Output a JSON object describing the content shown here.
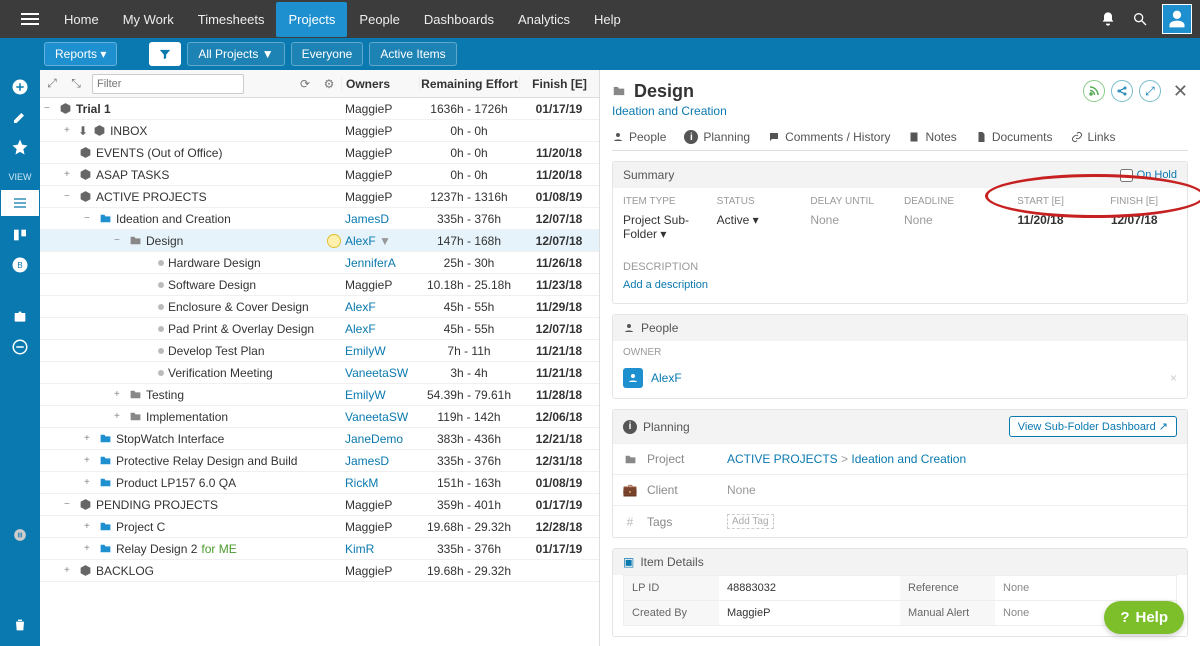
{
  "nav": {
    "items": [
      "Home",
      "My Work",
      "Timesheets",
      "Projects",
      "People",
      "Dashboards",
      "Analytics",
      "Help"
    ],
    "activeIndex": 3
  },
  "subnav": {
    "reports": "Reports ▾",
    "all_projects": "All Projects ▼",
    "everyone": "Everyone",
    "active_items": "Active Items"
  },
  "tree": {
    "filter_placeholder": "Filter",
    "headers": {
      "owners": "Owners",
      "effort": "Remaining Effort",
      "finish": "Finish [E]"
    },
    "rows": [
      {
        "indent": 0,
        "toggle": "−",
        "icon": "package",
        "label": "Trial 1",
        "owner": "MaggieP",
        "link": false,
        "effort": "1636h - 1726h",
        "finish": "01/17/19",
        "bold": true
      },
      {
        "indent": 1,
        "toggle": "+",
        "icon": "package",
        "pre": "download",
        "label": "INBOX",
        "owner": "MaggieP",
        "link": false,
        "effort": "0h - 0h",
        "finish": ""
      },
      {
        "indent": 1,
        "toggle": "",
        "icon": "package",
        "label": "EVENTS (Out of Office)",
        "owner": "MaggieP",
        "link": false,
        "effort": "0h - 0h",
        "finish": "11/20/18"
      },
      {
        "indent": 1,
        "toggle": "+",
        "icon": "package",
        "label": "ASAP TASKS",
        "owner": "MaggieP",
        "link": false,
        "effort": "0h - 0h",
        "finish": "11/20/18"
      },
      {
        "indent": 1,
        "toggle": "−",
        "icon": "package",
        "label": "ACTIVE PROJECTS",
        "owner": "MaggieP",
        "link": false,
        "effort": "1237h - 1316h",
        "finish": "01/08/19"
      },
      {
        "indent": 2,
        "toggle": "−",
        "icon": "folder-blue",
        "label": "Ideation and Creation",
        "owner": "JamesD",
        "link": true,
        "effort": "335h - 376h",
        "finish": "12/07/18"
      },
      {
        "indent": 3,
        "toggle": "−",
        "icon": "folder-grey",
        "label": "Design",
        "owner": "AlexF",
        "link": true,
        "ownerDrop": true,
        "effort": "147h - 168h",
        "finish": "12/07/18",
        "selected": true,
        "badge": true
      },
      {
        "indent": 4,
        "toggle": "",
        "icon": "task",
        "label": "Hardware Design",
        "owner": "JenniferA",
        "link": true,
        "effort": "25h - 30h",
        "finish": "11/26/18"
      },
      {
        "indent": 4,
        "toggle": "",
        "icon": "task",
        "label": "Software Design",
        "owner": "MaggieP",
        "link": false,
        "effort": "10.18h - 25.18h",
        "finish": "11/23/18"
      },
      {
        "indent": 4,
        "toggle": "",
        "icon": "task",
        "label": "Enclosure & Cover Design",
        "owner": "AlexF",
        "link": true,
        "effort": "45h - 55h",
        "finish": "11/29/18"
      },
      {
        "indent": 4,
        "toggle": "",
        "icon": "task",
        "label": "Pad Print & Overlay Design",
        "owner": "AlexF",
        "link": true,
        "effort": "45h - 55h",
        "finish": "12/07/18"
      },
      {
        "indent": 4,
        "toggle": "",
        "icon": "task",
        "label": "Develop Test Plan",
        "owner": "EmilyW",
        "link": true,
        "effort": "7h - 11h",
        "finish": "11/21/18"
      },
      {
        "indent": 4,
        "toggle": "",
        "icon": "task",
        "label": "Verification Meeting",
        "owner": "VaneetaSW",
        "link": true,
        "effort": "3h - 4h",
        "finish": "11/21/18"
      },
      {
        "indent": 3,
        "toggle": "+",
        "icon": "folder-grey",
        "label": "Testing",
        "owner": "EmilyW",
        "link": true,
        "effort": "54.39h - 79.61h",
        "finish": "11/28/18"
      },
      {
        "indent": 3,
        "toggle": "+",
        "icon": "folder-grey",
        "label": "Implementation",
        "owner": "VaneetaSW",
        "link": true,
        "effort": "119h - 142h",
        "finish": "12/06/18"
      },
      {
        "indent": 2,
        "toggle": "+",
        "icon": "folder-blue",
        "label": "StopWatch Interface",
        "owner": "JaneDemo",
        "link": true,
        "effort": "383h - 436h",
        "finish": "12/21/18"
      },
      {
        "indent": 2,
        "toggle": "+",
        "icon": "folder-blue",
        "label": "Protective Relay Design and Build",
        "owner": "JamesD",
        "link": true,
        "effort": "335h - 376h",
        "finish": "12/31/18"
      },
      {
        "indent": 2,
        "toggle": "+",
        "icon": "folder-blue",
        "label": "Product LP157 6.0 QA",
        "owner": "RickM",
        "link": true,
        "effort": "151h - 163h",
        "finish": "01/08/19"
      },
      {
        "indent": 1,
        "toggle": "−",
        "icon": "package",
        "label": "PENDING PROJECTS",
        "owner": "MaggieP",
        "link": false,
        "effort": "359h - 401h",
        "finish": "01/17/19"
      },
      {
        "indent": 2,
        "toggle": "+",
        "icon": "folder-blue",
        "label": "Project C",
        "owner": "MaggieP",
        "link": false,
        "effort": "19.68h - 29.32h",
        "finish": "12/28/18"
      },
      {
        "indent": 2,
        "toggle": "+",
        "icon": "folder-blue",
        "label": "Relay Design 2",
        "suffix": "for ME",
        "owner": "KimR",
        "link": true,
        "effort": "335h - 376h",
        "finish": "01/17/19"
      },
      {
        "indent": 1,
        "toggle": "+",
        "icon": "package",
        "label": "BACKLOG",
        "owner": "MaggieP",
        "link": false,
        "effort": "19.68h - 29.32h",
        "finish": ""
      }
    ]
  },
  "leftrail": {
    "view_label": "VIEW"
  },
  "detail": {
    "title": "Design",
    "breadcrumb": "Ideation and Creation",
    "tabs": [
      "People",
      "Planning",
      "Comments / History",
      "Notes",
      "Documents",
      "Links"
    ],
    "summary": {
      "header": "Summary",
      "onhold": "On Hold",
      "item_type_label": "ITEM TYPE",
      "item_type": "Project Sub-Folder ▾",
      "status_label": "STATUS",
      "status": "Active ▾",
      "delay_label": "DELAY UNTIL",
      "delay": "None",
      "deadline_label": "DEADLINE",
      "deadline": "None",
      "start_label": "START [E]",
      "start": "11/20/18",
      "finish_label": "FINISH [E]",
      "finish": "12/07/18",
      "desc_label": "DESCRIPTION",
      "add_desc": "Add a description"
    },
    "people": {
      "header": "People",
      "owner_label": "OWNER",
      "owner": "AlexF"
    },
    "planning": {
      "header": "Planning",
      "view_btn": "View Sub-Folder Dashboard ↗",
      "project_label": "Project",
      "project_path": [
        "ACTIVE PROJECTS",
        "Ideation and Creation"
      ],
      "client_label": "Client",
      "client": "None",
      "tags_label": "Tags",
      "tags_placeholder": "Add Tag"
    },
    "item_details": {
      "header": "Item Details",
      "lpid_label": "LP ID",
      "lpid": "48883032",
      "reference_label": "Reference",
      "reference": "None",
      "created_label": "Created By",
      "created": "MaggieP",
      "manual_label": "Manual Alert",
      "manual": "None"
    }
  },
  "help": "Help"
}
